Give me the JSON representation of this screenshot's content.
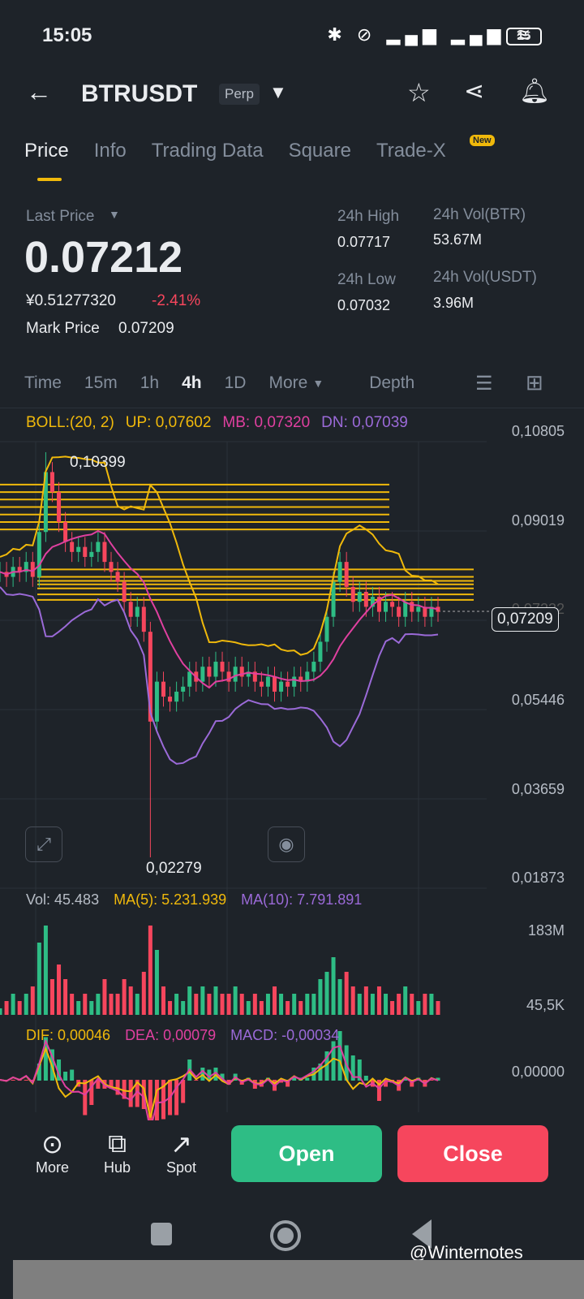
{
  "status": {
    "time": "15:05",
    "battery": "15"
  },
  "header": {
    "symbol": "BTRUSDT",
    "type": "Perp"
  },
  "tabs": [
    {
      "label": "Price"
    },
    {
      "label": "Info"
    },
    {
      "label": "Trading Data"
    },
    {
      "label": "Square"
    },
    {
      "label": "Trade-X"
    }
  ],
  "new_badge": "New",
  "ticker": {
    "last_price_label": "Last Price",
    "last_price": "0.07212",
    "cny": "¥0.51277320",
    "change": "-2.41%",
    "mark_label": "Mark Price",
    "mark_price": "0.07209",
    "high_label": "24h High",
    "high": "0.07717",
    "low_label": "24h Low",
    "low": "0.07032",
    "vol_btr_label": "24h Vol(BTR)",
    "vol_btr": "53.67M",
    "vol_usdt_label": "24h Vol(USDT)",
    "vol_usdt": "3.96M"
  },
  "timeframes": [
    "Time",
    "15m",
    "1h",
    "4h",
    "1D",
    "More",
    "Depth"
  ],
  "indicators": {
    "boll": "BOLL:(20, 2)",
    "up": "UP: 0,07602",
    "mb": "MB: 0,07320",
    "dn": "DN: 0,07039",
    "vol": "Vol: 45.483",
    "ma5": "MA(5): 5.231.939",
    "ma10": "MA(10): 7.791.891",
    "dif": "DIF: 0,00046",
    "dea": "DEA: 0,00079",
    "macd": "MACD: -0,00034"
  },
  "axis": {
    "price_ticks": [
      "0,10805",
      "0,09019",
      "0,07232",
      "0,05446",
      "0,03659",
      "0,01873"
    ],
    "current": "0,07209",
    "high_mark": "0,10399",
    "low_mark": "0,02279",
    "vol_ticks": [
      "183M",
      "45,5K"
    ],
    "macd_tick": "0,00000"
  },
  "bottom": {
    "more": "More",
    "hub": "Hub",
    "spot": "Spot",
    "open": "Open",
    "close": "Close"
  },
  "watermark": "@Winternotes",
  "colors": {
    "up": "#2ebd85",
    "down": "#f6465d",
    "accent": "#f0b90b",
    "mb": "#e040a0",
    "dn": "#9b6ad8"
  },
  "chart_data": {
    "type": "candlestick",
    "ylim": [
      0.01873,
      0.10805
    ],
    "closes": [
      0.08,
      0.079,
      0.081,
      0.08,
      0.082,
      0.079,
      0.088,
      0.1,
      0.096,
      0.09,
      0.086,
      0.084,
      0.085,
      0.083,
      0.084,
      0.086,
      0.082,
      0.08,
      0.078,
      0.074,
      0.071,
      0.073,
      0.068,
      0.05,
      0.058,
      0.055,
      0.054,
      0.056,
      0.057,
      0.06,
      0.058,
      0.061,
      0.059,
      0.062,
      0.06,
      0.058,
      0.061,
      0.059,
      0.06,
      0.058,
      0.057,
      0.059,
      0.056,
      0.058,
      0.057,
      0.059,
      0.058,
      0.06,
      0.062,
      0.066,
      0.071,
      0.078,
      0.082,
      0.077,
      0.074,
      0.076,
      0.073,
      0.075,
      0.072,
      0.074,
      0.073,
      0.071,
      0.074,
      0.072,
      0.073,
      0.071,
      0.073,
      0.072
    ]
  }
}
